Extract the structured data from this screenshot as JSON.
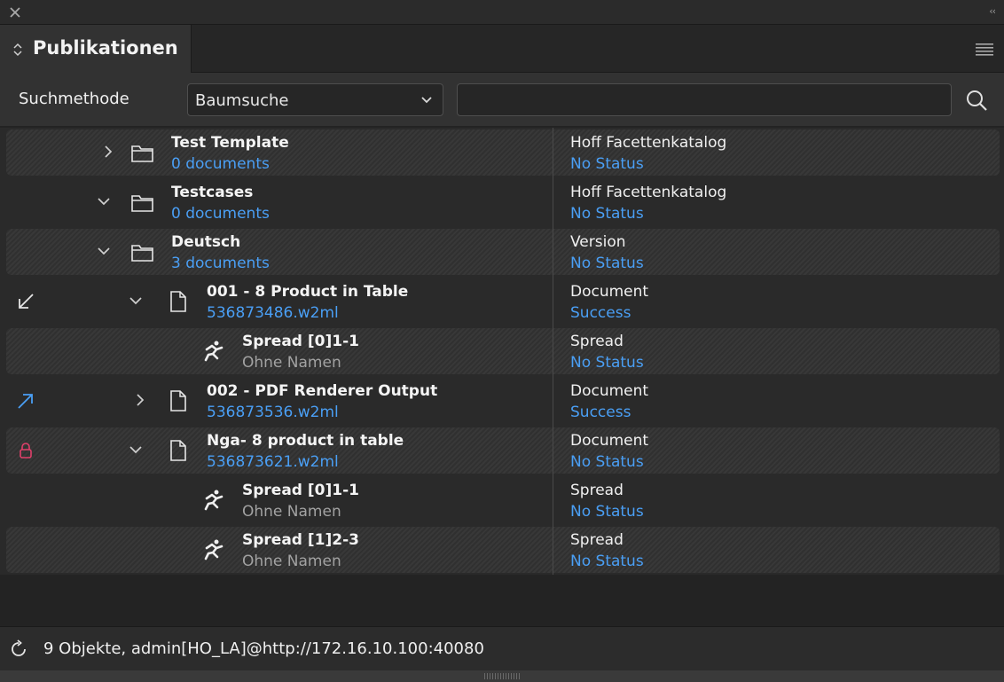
{
  "panel": {
    "title": "Publikationen"
  },
  "search": {
    "method_label": "Suchmethode",
    "method_value": "Baumsuche",
    "query": "",
    "placeholder": ""
  },
  "tree": [
    {
      "name": "Test Template",
      "sub": "0 documents",
      "type": "Hoff Facettenkatalog",
      "status": "No Status",
      "node": "folder",
      "expander": "collapsed",
      "level": 0,
      "marker": "",
      "sub_style": "link"
    },
    {
      "name": "Testcases",
      "sub": "0 documents",
      "type": "Hoff Facettenkatalog",
      "status": "No Status",
      "node": "folder",
      "expander": "expanded",
      "level": 0,
      "marker": "",
      "sub_style": "link"
    },
    {
      "name": "Deutsch",
      "sub": "3 documents",
      "type": "Version",
      "status": "No Status",
      "node": "folder",
      "expander": "expanded",
      "level": 1,
      "marker": "",
      "sub_style": "link"
    },
    {
      "name": "001 - 8 Product in Table",
      "sub": "536873486.w2ml",
      "type": "Document",
      "status": "Success",
      "node": "document",
      "expander": "expanded",
      "level": 2,
      "marker": "checked-in-arrow",
      "sub_style": "link"
    },
    {
      "name": "Spread [0]1-1",
      "sub": "Ohne Namen",
      "type": "Spread",
      "status": "No Status",
      "node": "spread",
      "expander": "",
      "level": 3,
      "marker": "",
      "sub_style": "grey"
    },
    {
      "name": "002 - PDF Renderer Output",
      "sub": "536873536.w2ml",
      "type": "Document",
      "status": "Success",
      "node": "document",
      "expander": "collapsed",
      "level": 2,
      "marker": "checked-out-arrow",
      "sub_style": "link"
    },
    {
      "name": "Nga- 8 product in table",
      "sub": "536873621.w2ml",
      "type": "Document",
      "status": "No Status",
      "node": "document",
      "expander": "expanded",
      "level": 2,
      "marker": "lock",
      "sub_style": "link"
    },
    {
      "name": "Spread [0]1-1",
      "sub": "Ohne Namen",
      "type": "Spread",
      "status": "No Status",
      "node": "spread",
      "expander": "",
      "level": 3,
      "marker": "",
      "sub_style": "grey"
    },
    {
      "name": "Spread [1]2-3",
      "sub": "Ohne Namen",
      "type": "Spread",
      "status": "No Status",
      "node": "spread",
      "expander": "",
      "level": 3,
      "marker": "",
      "sub_style": "grey"
    }
  ],
  "statusbar": {
    "text": "9 Objekte, admin[HO_LA]@http://172.16.10.100:40080"
  },
  "colors": {
    "link": "#4a9ff5",
    "lock": "#e0406a",
    "arrow_out": "#4a9ff5"
  }
}
